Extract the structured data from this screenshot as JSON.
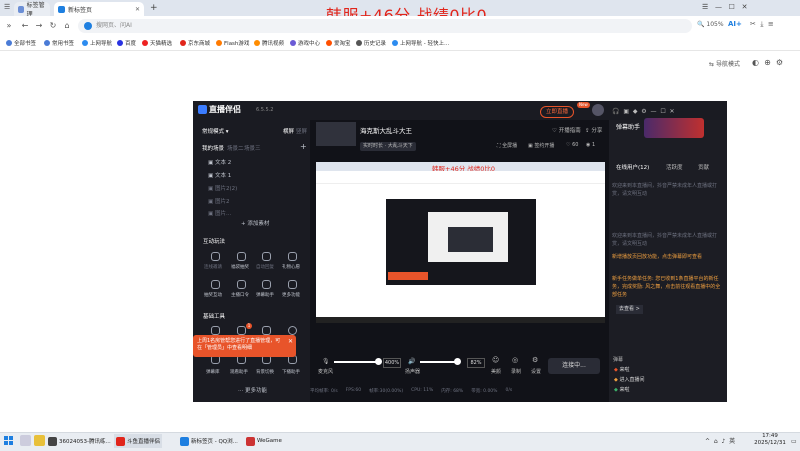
{
  "overlay_text": "韩服+46分    战绩0比0",
  "browser": {
    "tabs": [
      {
        "label": "标签管理",
        "active": false
      },
      {
        "label": "新标签页",
        "active": true
      }
    ],
    "new_tab": "+",
    "address_placeholder": "搜网页、问AI",
    "zoom": "105%",
    "ai_label": "AI+",
    "bookmarks": [
      {
        "label": "全部书签",
        "color": "#4a7bd6"
      },
      {
        "label": "常用书签",
        "color": "#4a7bd6"
      },
      {
        "label": "上网导航",
        "color": "#2d8cf0"
      },
      {
        "label": "百度",
        "color": "#2932e1"
      },
      {
        "label": "天猫精选",
        "color": "#e22"
      },
      {
        "label": "京东商城",
        "color": "#e1251b"
      },
      {
        "label": "Flash游戏",
        "color": "#ff7a00"
      },
      {
        "label": "腾讯视频",
        "color": "#ff8c00"
      },
      {
        "label": "游戏中心",
        "color": "#6b5bd6"
      },
      {
        "label": "爱淘宝",
        "color": "#ff5000"
      },
      {
        "label": "历史记录",
        "color": "#555"
      },
      {
        "label": "上网导航 - 轻快上...",
        "color": "#2d8cf0"
      }
    ],
    "nav_mode": "导航模式"
  },
  "app": {
    "logo": "直播伴侣",
    "version": "6.5.5.2",
    "live_status": "立即直播",
    "mode": "常规模式",
    "left_tabs": [
      "横屏",
      "竖屏"
    ],
    "scene_tabs": [
      "我的场景",
      "场景二",
      "场景三"
    ],
    "scene_add": "+",
    "sources": [
      "文本 2",
      "文本 1",
      "图片2(2)",
      "图片2",
      "图片..."
    ],
    "add_source": "+ 添加素材",
    "interaction_title": "互动玩法",
    "interaction_items": [
      "连线邀请",
      "福袋抽奖",
      "自动回复",
      "礼物心愿",
      "抽奖互动",
      "主播口令",
      "弹幕助手",
      "更多功能"
    ],
    "tools_title": "基础工具",
    "tools_items": [
      "弹幕墙",
      "画笔",
      "提示",
      "下载工具",
      "弹幕库",
      "观看助手",
      "背景切换",
      "下播助手"
    ],
    "more": "更多功能",
    "popup_text": "上周1名房管帮您进行了直播管理，可在「管理员」中查看明细",
    "room_title": "海克斯大乱斗大王",
    "room_sub": "实时时长 · 大乱斗天下",
    "top_actions": [
      "开播指南",
      "分享"
    ],
    "status_row": [
      "全屏播",
      "签约开播",
      "60",
      "1"
    ],
    "mic_label": "麦克风",
    "mic_value": "400%",
    "speaker_label": "扬声器",
    "speaker_value": "82%",
    "beauty_label": "美颜",
    "record_label": "录制",
    "settings_label": "设置",
    "start_live": "连接中...",
    "stats": [
      "平均帧率: 0/s",
      "FPS:60",
      "帧率:30(0.00%)",
      "CPU: 11%",
      "内存: 68%",
      "带宽: 0.00%",
      "0/s"
    ],
    "right_title": "弹幕助手",
    "right_tabs": [
      "在线用户(12)",
      "活跃度",
      "贡献"
    ],
    "chat_notice_1": "欢迎来到本直播间，抖音严禁未成年人直播或打赏，请文明互动",
    "chat_notice_2": "欢迎来到本直播间，抖音严禁未成年人直播或打赏，请文明互动",
    "chat_highlight": "新增播放页回放功能，点击弹幕即可查看",
    "task_text": "新手任务做单任务: 您已收到1条直播平台的新任务，完成奖励: 风之舞，点击前往观看直播中的全部任务",
    "go_see": "去查看 >",
    "gift_title": "弹幕",
    "gift_rows": [
      "来啦",
      "进入直播间",
      "来啦"
    ]
  },
  "taskbar": {
    "items": [
      {
        "label": "36024053-腾讯练...",
        "color": "#444"
      },
      {
        "label": "斗鱼直播伴侣",
        "color": "#e1251b"
      },
      {
        "label": "新标签页 - QQ浏...",
        "color": "#1e7fe0"
      },
      {
        "label": "WeGame",
        "color": "#cc3333"
      }
    ],
    "ime": "英",
    "time": "17:49",
    "date": "2025/12/31"
  },
  "preview_overlay": "韩服+46分    战绩0比0"
}
